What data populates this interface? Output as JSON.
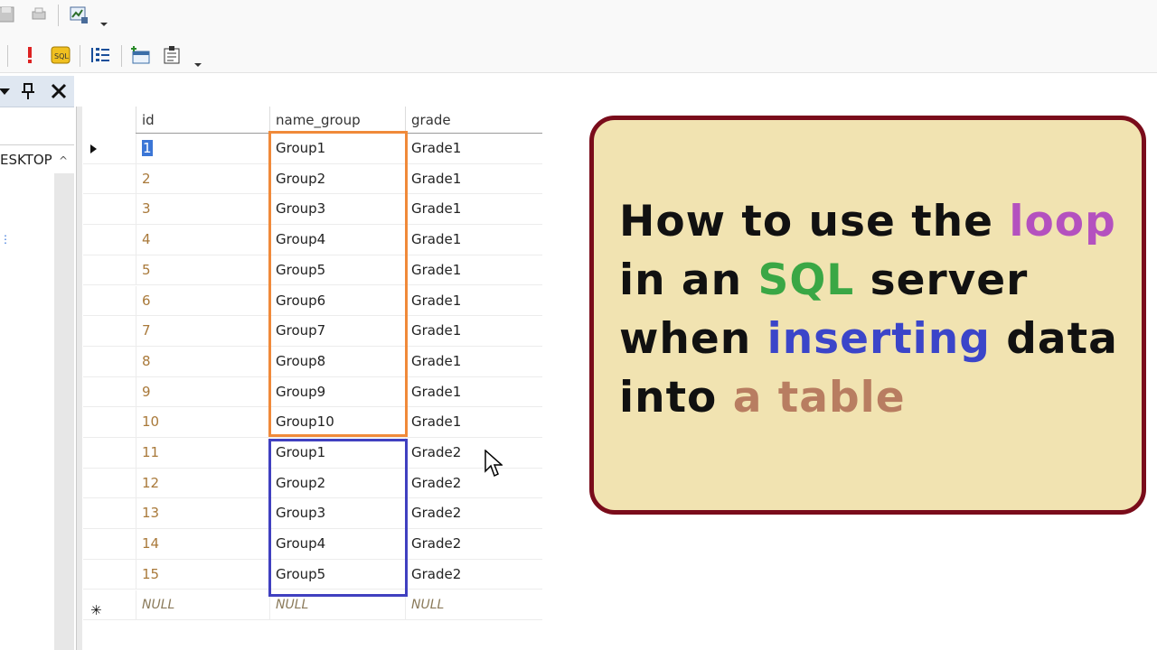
{
  "toolbar": {
    "row1_icons": [
      "save-icon",
      "print-icon",
      "results-to-grid-icon"
    ],
    "row2_icons": [
      "execute-icon",
      "sql-icon",
      "list-icon",
      "add-table-icon",
      "properties-icon"
    ]
  },
  "explorer": {
    "node_label": "ESKTOP",
    "icons": [
      "dropdown-icon",
      "pin-icon",
      "close-icon"
    ]
  },
  "grid": {
    "columns": [
      "id",
      "name_group",
      "grade"
    ],
    "rows": [
      {
        "id": "1",
        "name_group": "Group1",
        "grade": "Grade1"
      },
      {
        "id": "2",
        "name_group": "Group2",
        "grade": "Grade1"
      },
      {
        "id": "3",
        "name_group": "Group3",
        "grade": "Grade1"
      },
      {
        "id": "4",
        "name_group": "Group4",
        "grade": "Grade1"
      },
      {
        "id": "5",
        "name_group": "Group5",
        "grade": "Grade1"
      },
      {
        "id": "6",
        "name_group": "Group6",
        "grade": "Grade1"
      },
      {
        "id": "7",
        "name_group": "Group7",
        "grade": "Grade1"
      },
      {
        "id": "8",
        "name_group": "Group8",
        "grade": "Grade1"
      },
      {
        "id": "9",
        "name_group": "Group9",
        "grade": "Grade1"
      },
      {
        "id": "10",
        "name_group": "Group10",
        "grade": "Grade1"
      },
      {
        "id": "11",
        "name_group": "Group1",
        "grade": "Grade2"
      },
      {
        "id": "12",
        "name_group": "Group2",
        "grade": "Grade2"
      },
      {
        "id": "13",
        "name_group": "Group3",
        "grade": "Grade2"
      },
      {
        "id": "14",
        "name_group": "Group4",
        "grade": "Grade2"
      },
      {
        "id": "15",
        "name_group": "Group5",
        "grade": "Grade2"
      }
    ],
    "new_row": {
      "id": "NULL",
      "name_group": "NULL",
      "grade": "NULL"
    },
    "highlight_colors": {
      "grade1_group": "#f08a3a",
      "grade2_group": "#4040c0"
    }
  },
  "title_card": {
    "lines": [
      [
        {
          "text": "How to use the "
        },
        {
          "text": "loop",
          "hl": "loop"
        }
      ],
      [
        {
          "text": "in an "
        },
        {
          "text": "SQL",
          "hl": "sql"
        },
        {
          "text": " server"
        }
      ],
      [
        {
          "text": "when "
        },
        {
          "text": "inserting",
          "hl": "insert"
        },
        {
          "text": " data"
        }
      ],
      [
        {
          "text": "into "
        },
        {
          "text": "a table",
          "hl": "table"
        }
      ]
    ],
    "colors": {
      "background": "#f1e3b1",
      "border": "#7a0c1b",
      "loop": "#b451bf",
      "sql": "#3aa745",
      "inserting": "#3b45c9",
      "table": "#b87d61"
    }
  }
}
